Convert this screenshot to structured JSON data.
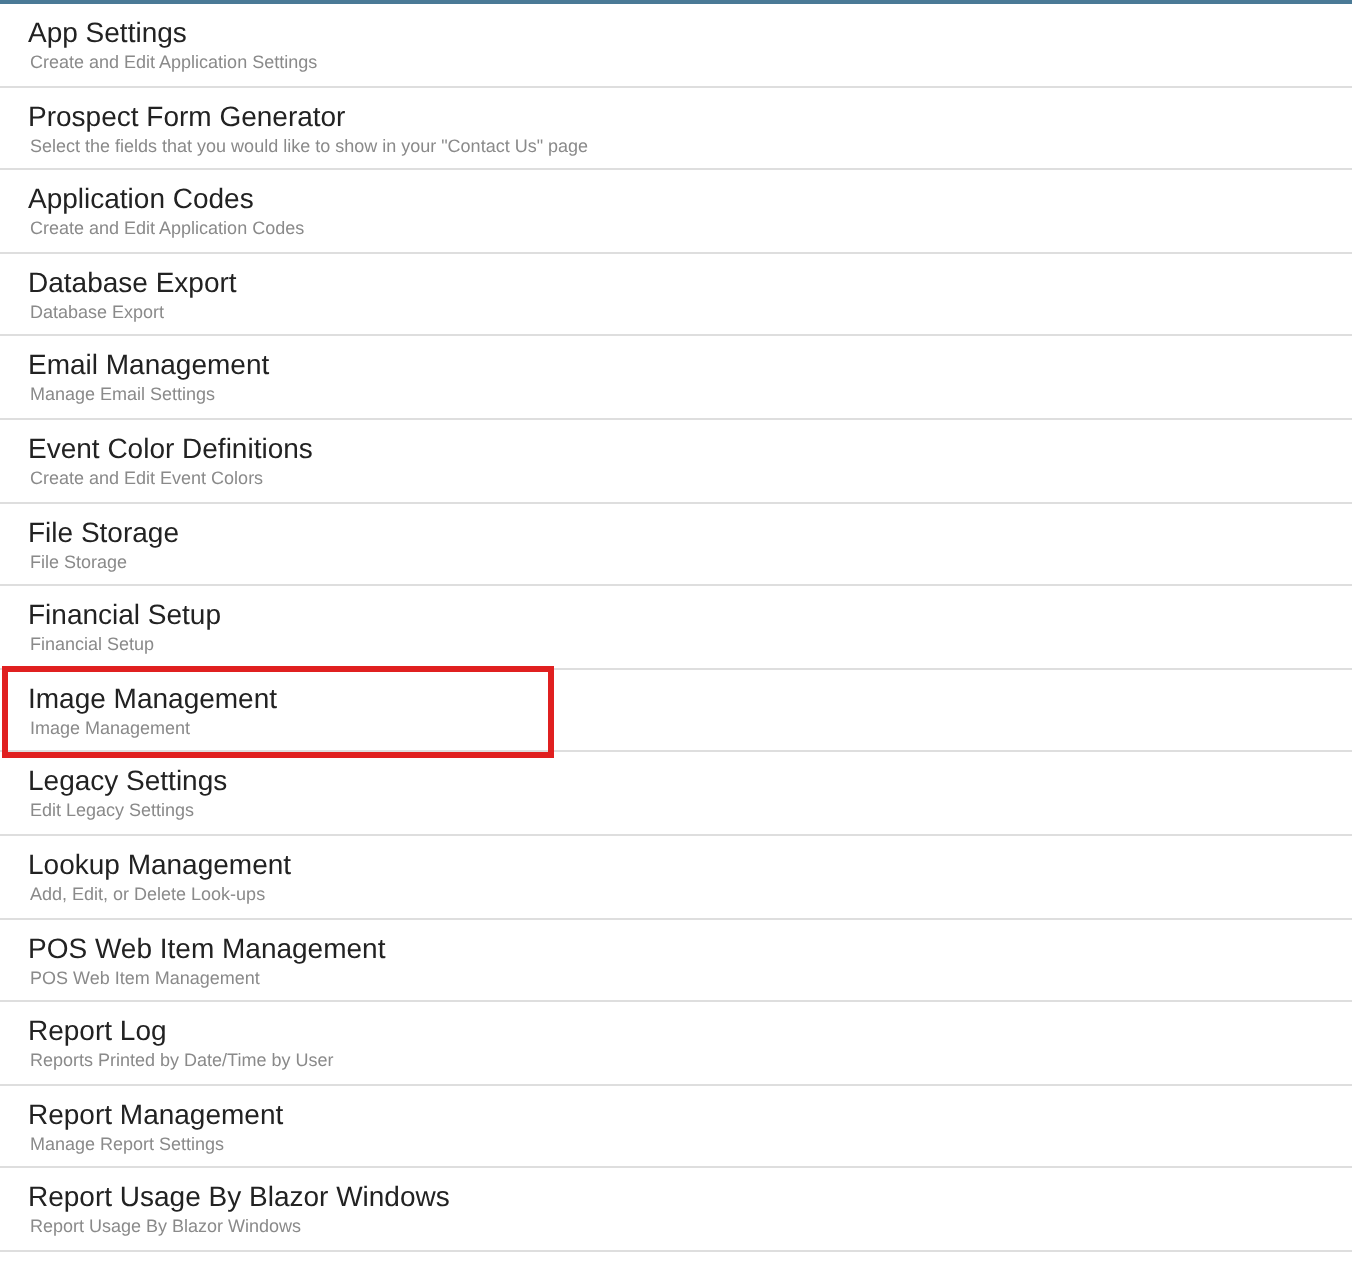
{
  "items": [
    {
      "title": "App Settings",
      "description": "Create and Edit Application Settings",
      "highlighted": false
    },
    {
      "title": "Prospect Form Generator",
      "description": "Select the fields that you would like to show in your \"Contact Us\" page",
      "highlighted": false
    },
    {
      "title": "Application Codes",
      "description": "Create and Edit Application Codes",
      "highlighted": false
    },
    {
      "title": "Database Export",
      "description": "Database Export",
      "highlighted": false
    },
    {
      "title": "Email Management",
      "description": "Manage Email Settings",
      "highlighted": false
    },
    {
      "title": "Event Color Definitions",
      "description": "Create and Edit Event Colors",
      "highlighted": false
    },
    {
      "title": "File Storage",
      "description": "File Storage",
      "highlighted": false
    },
    {
      "title": "Financial Setup",
      "description": "Financial Setup",
      "highlighted": false
    },
    {
      "title": "Image Management",
      "description": "Image Management",
      "highlighted": true
    },
    {
      "title": "Legacy Settings",
      "description": "Edit Legacy Settings",
      "highlighted": false
    },
    {
      "title": "Lookup Management",
      "description": "Add, Edit, or Delete Look-ups",
      "highlighted": false
    },
    {
      "title": "POS Web Item Management",
      "description": "POS Web Item Management",
      "highlighted": false
    },
    {
      "title": "Report Log",
      "description": "Reports Printed by Date/Time by User",
      "highlighted": false
    },
    {
      "title": "Report Management",
      "description": "Manage Report Settings",
      "highlighted": false
    },
    {
      "title": "Report Usage By Blazor Windows",
      "description": "Report Usage By Blazor Windows",
      "highlighted": false
    }
  ]
}
